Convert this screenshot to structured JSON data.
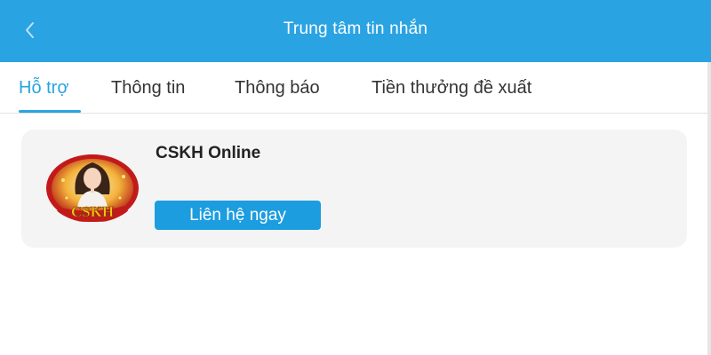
{
  "header": {
    "title": "Trung tâm tin nhắn",
    "back_icon": "chevron-left-icon"
  },
  "tabs": [
    {
      "label": "Hỗ trợ",
      "active": true
    },
    {
      "label": "Thông tin",
      "active": false
    },
    {
      "label": "Thông báo",
      "active": false
    },
    {
      "label": "Tiền thưởng đề xuất",
      "active": false
    }
  ],
  "support_card": {
    "title": "CSKH Online",
    "button_label": "Liên hệ ngay",
    "avatar_logo_text": "CSKH"
  },
  "colors": {
    "accent": "#2aa3e3",
    "button": "#1b9ddf",
    "card_bg": "#f4f4f4",
    "avatar_ring": "#c21a1a",
    "avatar_logo": "#f5c518"
  }
}
